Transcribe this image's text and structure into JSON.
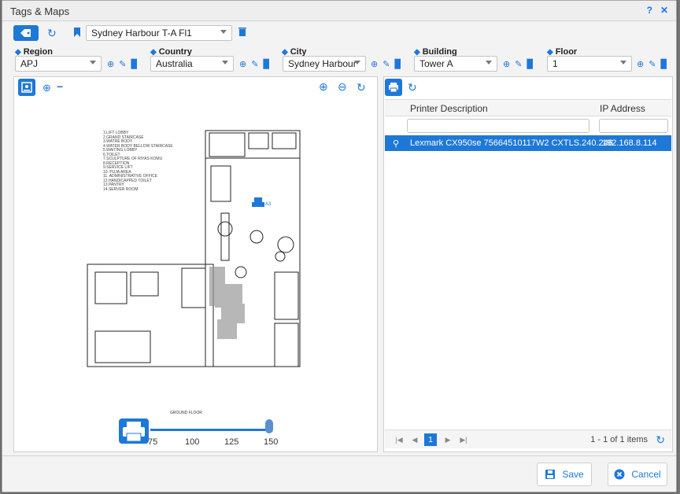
{
  "window": {
    "title": "Tags & Maps",
    "help_icon": "help-circle-icon",
    "close_icon": "close-icon"
  },
  "toolbar": {
    "floor_selection": "Sydney Harbour T-A Fl1"
  },
  "filters": {
    "region": {
      "label": "Region",
      "value": "APJ"
    },
    "country": {
      "label": "Country",
      "value": "Australia"
    },
    "city": {
      "label": "City",
      "value": "Sydney Harbour"
    },
    "building": {
      "label": "Building",
      "value": "Tower A"
    },
    "floor": {
      "label": "Floor",
      "value": "1"
    }
  },
  "map": {
    "legend": "1.LIFT LOBBY\n2.GRAND STAIRCASE\n3.WATRE BODY\n4.WATER BODY BELLOW STAIRCASE\n5.WAITING LOBBY\n6.TOILET\n7.SCULPTURE OF RIYAS KOMU\n8.RECEPTION\n9.SERVICE LIFT\n10. PUJA AREA\n11. ADMINISTRATIVE OFFICE\n12.HANDICAPPED TOILET\n13.PANTRY\n14.SERVER ROOM",
    "floor_label": "GROUND FLOOR",
    "printer_tag": "A3",
    "zoom_ticks": [
      "75",
      "100",
      "125",
      "150"
    ],
    "zoom_value": 150
  },
  "grid": {
    "columns": [
      "Printer Description",
      "IP Address"
    ],
    "rows": [
      {
        "description": "Lexmark CX950se 75664510117W2 CXTLS.240.246",
        "ip": "192.168.8.114"
      }
    ],
    "pager": {
      "current_page": "1",
      "info": "1 - 1 of 1 items"
    }
  },
  "footer": {
    "save_label": "Save",
    "cancel_label": "Cancel"
  },
  "colors": {
    "accent": "#1e78d8",
    "selected_row": "#1e78d8"
  }
}
